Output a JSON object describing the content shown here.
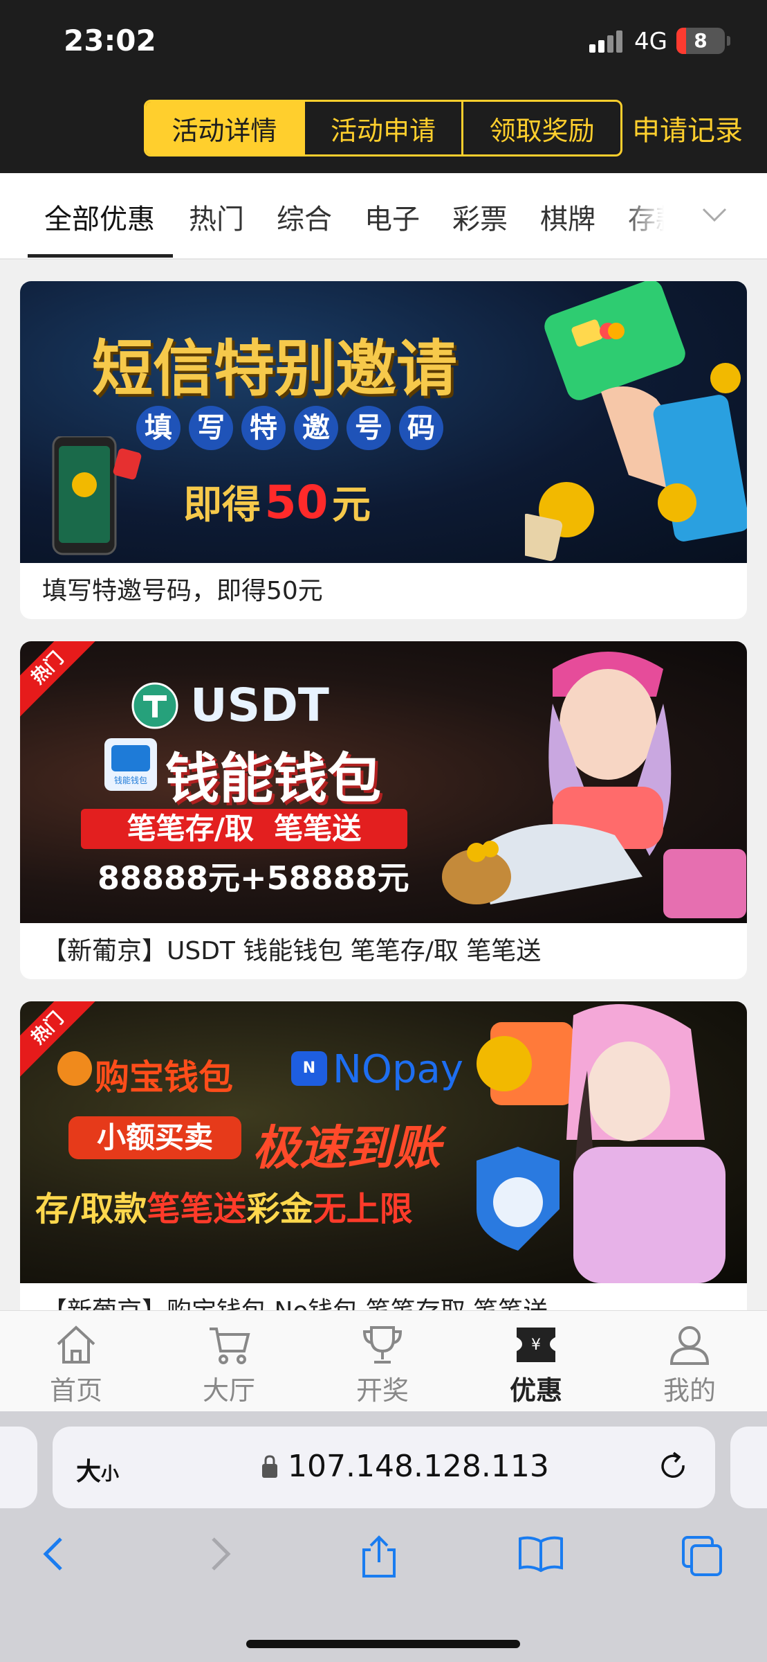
{
  "status": {
    "time": "23:02",
    "network": "4G",
    "battery": "8"
  },
  "header": {
    "segments": [
      {
        "label": "活动详情",
        "active": true
      },
      {
        "label": "活动申请",
        "active": false
      },
      {
        "label": "领取奖励",
        "active": false
      }
    ],
    "apply_record": "申请记录"
  },
  "categories": {
    "items": [
      "全部优惠",
      "热门",
      "综合",
      "电子",
      "彩票",
      "棋牌",
      "存款"
    ],
    "active_index": 0
  },
  "promos": [
    {
      "hot": false,
      "banner": {
        "title": "短信特别邀请",
        "subtitle_chars": [
          "填",
          "写",
          "特",
          "邀",
          "号",
          "码"
        ],
        "line3_prefix": "即得",
        "line3_amount": "50",
        "line3_suffix": "元"
      },
      "caption": "填写特邀号码，即得50元"
    },
    {
      "hot": true,
      "hot_label": "热门",
      "banner": {
        "title_top": "USDT",
        "title_main": "钱能钱包",
        "tag": "笔笔存/取  笔笔送",
        "amount": "88888元+58888元",
        "logo_caption": "钱能钱包"
      },
      "caption": "【新葡京】USDT 钱能钱包 笔笔存/取 笔笔送"
    },
    {
      "hot": true,
      "hot_label": "热门",
      "banner": {
        "brand1": "购宝钱包",
        "brand2": "NOpay",
        "tag": "小额买卖",
        "slogan": "极速到账",
        "line3_a": "存/取款",
        "line3_b": "笔笔送",
        "line3_c": "彩金",
        "line3_d": "无上限"
      },
      "caption": "【新葡京】购宝钱包 No钱包 笔笔存取 笔笔送"
    }
  ],
  "tabbar": {
    "items": [
      {
        "label": "首页",
        "icon": "home-icon",
        "active": false
      },
      {
        "label": "大厅",
        "icon": "cart-icon",
        "active": false
      },
      {
        "label": "开奖",
        "icon": "trophy-icon",
        "active": false
      },
      {
        "label": "优惠",
        "icon": "ticket-icon",
        "active": true
      },
      {
        "label": "我的",
        "icon": "user-icon",
        "active": false
      }
    ]
  },
  "browser": {
    "text_size_label": "大",
    "text_size_small": "小",
    "url": "107.148.128.113"
  }
}
